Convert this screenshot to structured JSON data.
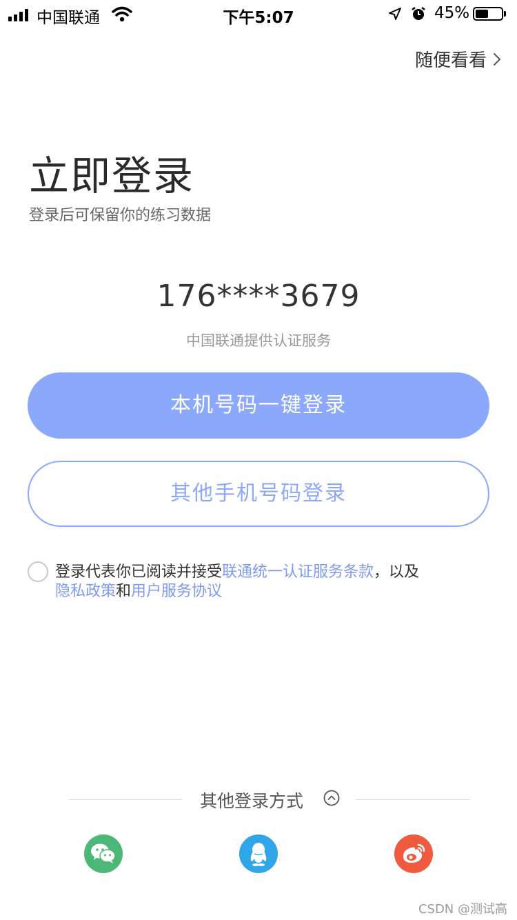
{
  "status_bar": {
    "carrier": "中国联通",
    "time": "下午5:07",
    "battery": "45%",
    "battery_level": 0.45
  },
  "header": {
    "skip_label": "随便看看"
  },
  "login": {
    "title": "立即登录",
    "subtitle": "登录后可保留你的练习数据",
    "phone_masked": "176****3679",
    "provider_note": "中国联通提供认证服务",
    "one_click_label": "本机号码一键登录",
    "other_phone_label": "其他手机号码登录"
  },
  "agreement": {
    "prefix": "登录代表你已阅读并接受",
    "link_terms": "联通统一认证服务条款",
    "sep": "，以及",
    "link_privacy": "隐私政策",
    "and": "和",
    "link_user": "用户服务协议",
    "checked": false
  },
  "other_login": {
    "label": "其他登录方式",
    "icons": [
      "wechat-icon",
      "qq-icon",
      "weibo-icon"
    ]
  },
  "watermark": "CSDN @测试高",
  "colors": {
    "accent": "#8ca8fb",
    "link": "#7d9af0",
    "wechat": "#4cb877",
    "qq": "#2fa6e8",
    "weibo": "#ef5a3f"
  }
}
